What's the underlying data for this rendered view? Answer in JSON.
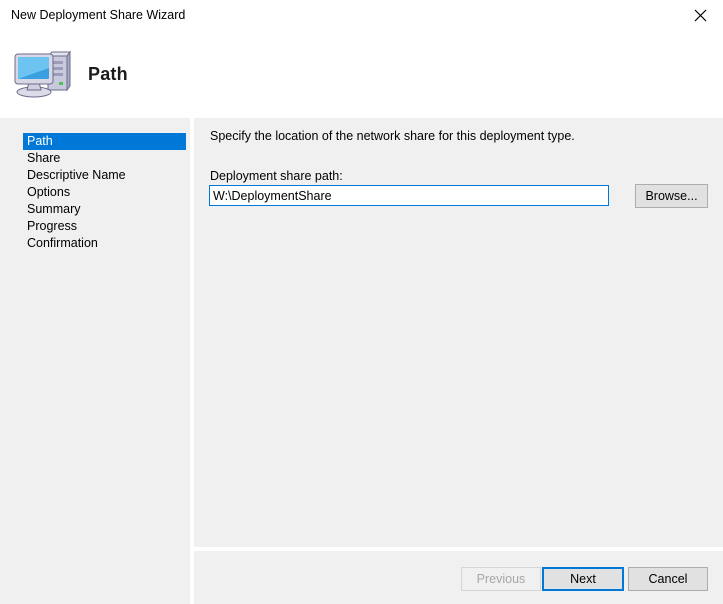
{
  "window": {
    "title": "New Deployment Share Wizard",
    "close_icon": "close-icon"
  },
  "header": {
    "title": "Path",
    "icon": "computer-icon"
  },
  "sidebar": {
    "items": [
      {
        "label": "Path",
        "selected": true
      },
      {
        "label": "Share",
        "selected": false
      },
      {
        "label": "Descriptive Name",
        "selected": false
      },
      {
        "label": "Options",
        "selected": false
      },
      {
        "label": "Summary",
        "selected": false
      },
      {
        "label": "Progress",
        "selected": false
      },
      {
        "label": "Confirmation",
        "selected": false
      }
    ]
  },
  "main": {
    "instruction": "Specify the location of the network share for this deployment type.",
    "field_label": "Deployment share path:",
    "path_value": "W:\\DeploymentShare",
    "path_placeholder": "",
    "browse_label": "Browse..."
  },
  "footer": {
    "previous_label": "Previous",
    "next_label": "Next",
    "cancel_label": "Cancel"
  },
  "colors": {
    "accent": "#0078d7",
    "panel": "#f0f0f0",
    "button_face": "#e1e1e1",
    "button_border": "#adadad",
    "disabled_text": "#a6a6a6"
  }
}
